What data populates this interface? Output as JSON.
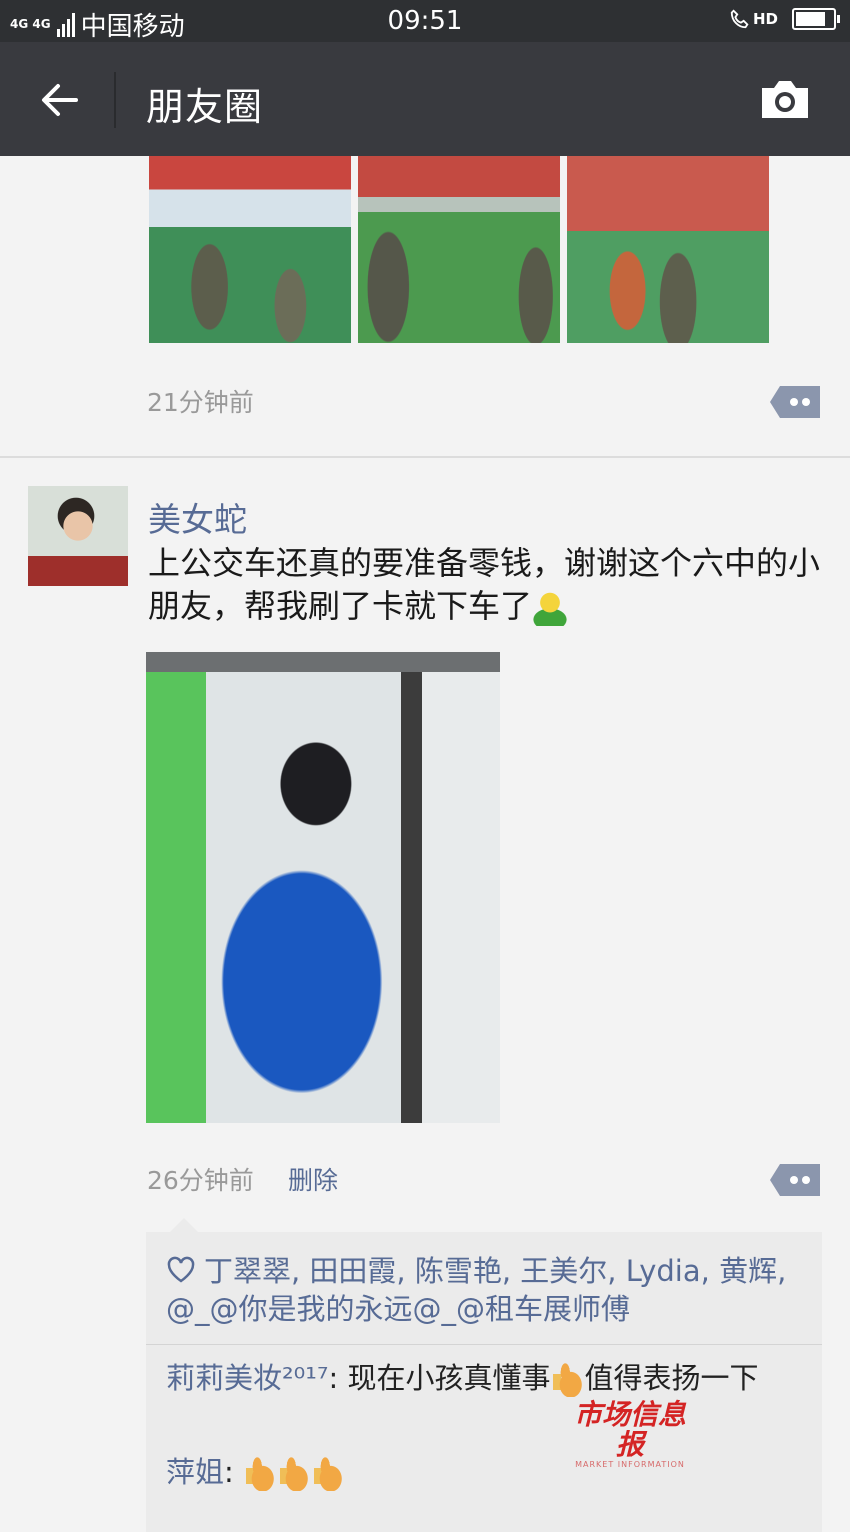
{
  "status_bar": {
    "network": "4G 4G",
    "carrier": "中国移动",
    "time": "09:51",
    "hd": "HD",
    "battery_level": 0.85
  },
  "header": {
    "title": "朋友圈"
  },
  "post1": {
    "time": "21分钟前"
  },
  "post2": {
    "author": "美女蛇",
    "text": "上公交车还真的要准备零钱，谢谢这个六中的小朋友，帮我刷了卡就下车了",
    "time": "26分钟前",
    "delete_label": "删除",
    "likes": "丁翠翠, 田田霞, 陈雪艳, 王美尔, Lydia, 黄辉, @_@你是我的永远@_@租车展师傅",
    "comments": [
      {
        "author": "莉莉美妆²⁰¹⁷",
        "sep": ": ",
        "text_before": "现在小孩真懂事",
        "text_after": "值得表扬一下"
      },
      {
        "author": "萍姐",
        "sep": ": "
      }
    ]
  },
  "watermark": {
    "main": "市场信息报",
    "sub": "MARKET INFORMATION"
  },
  "colors": {
    "accent_link": "#576b95",
    "header_bg": "#393a3f",
    "status_bg": "#2e3033",
    "page_bg": "#f3f3f3"
  },
  "icons": [
    "back-arrow-icon",
    "camera-icon",
    "comment-dots-icon",
    "heart-outline-icon",
    "thumbs-up-icon",
    "smiley-emoji-icon"
  ]
}
